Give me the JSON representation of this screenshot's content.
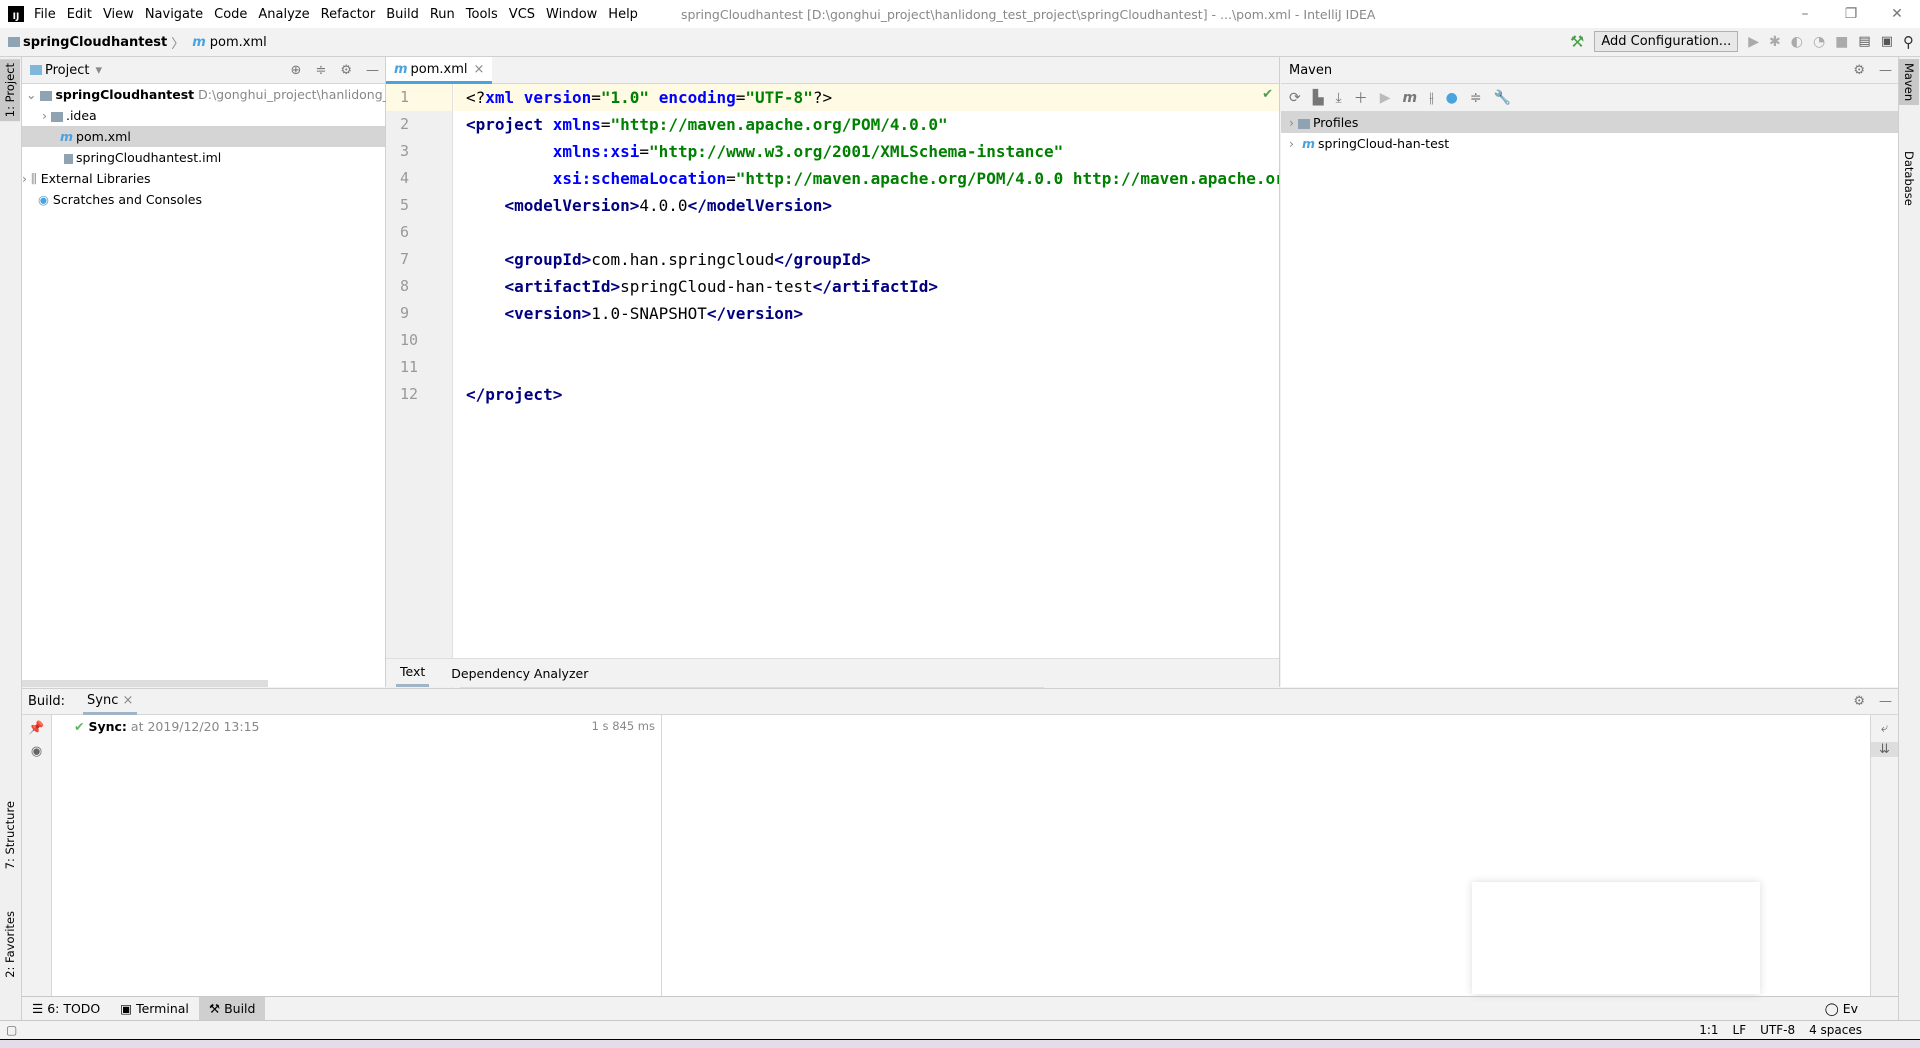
{
  "window": {
    "title": "springCloudhantest [D:\\gonghui_project\\hanlidong_test_project\\springCloudhantest] - ...\\pom.xml - IntelliJ IDEA",
    "logo": "IJ",
    "min": "–",
    "restore": "❐",
    "close": "✕"
  },
  "menu": [
    "File",
    "Edit",
    "View",
    "Navigate",
    "Code",
    "Analyze",
    "Refactor",
    "Build",
    "Run",
    "Tools",
    "VCS",
    "Window",
    "Help"
  ],
  "breadcrumb": {
    "project": "springCloudhantest",
    "file": "pom.xml"
  },
  "toolbar": {
    "add_configuration": "Add Configuration..."
  },
  "left_stripe": {
    "project": "1: Project",
    "structure": "7: Structure",
    "favorites": "2: Favorites"
  },
  "right_stripe": {
    "maven": "Maven",
    "database": "Database"
  },
  "project_panel": {
    "title": "Project",
    "tree": [
      {
        "label": "springCloudhantest",
        "path": "D:\\gonghui_project\\hanlidong_tes"
      },
      {
        "label": ".idea"
      },
      {
        "label": "pom.xml"
      },
      {
        "label": "springCloudhantest.iml"
      },
      {
        "label": "External Libraries"
      },
      {
        "label": "Scratches and Consoles"
      }
    ]
  },
  "editor": {
    "tab": "pom.xml",
    "line_numbers": [
      "1",
      "2",
      "3",
      "4",
      "5",
      "6",
      "7",
      "8",
      "9",
      "10",
      "11",
      "12"
    ],
    "bottom_tabs": [
      "Text",
      "Dependency Analyzer"
    ],
    "active_bottom_tab": "Text"
  },
  "maven": {
    "title": "Maven",
    "items": [
      "Profiles",
      "springCloud-han-test"
    ]
  },
  "build": {
    "label": "Build:",
    "tab": "Sync",
    "entry_title": "Sync:",
    "entry_time": "at 2019/12/20 13:15",
    "duration": "1 s 845 ms"
  },
  "tool_tabs": [
    "6: TODO",
    "Terminal",
    "Build"
  ],
  "status": {
    "position": "1:1",
    "line_sep": "LF",
    "encoding": "UTF-8",
    "indent": "4 spaces",
    "event_log": "Ev"
  },
  "colors": {
    "accent": "#4aa3df",
    "tag": "#000080",
    "attr": "#0000ff",
    "value": "#008000"
  }
}
